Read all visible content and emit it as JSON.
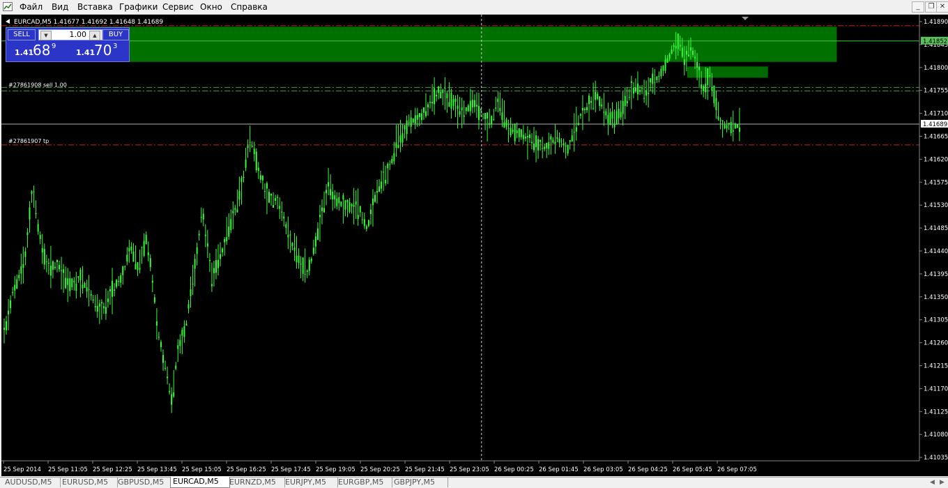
{
  "menu": [
    "Файл",
    "Вид",
    "Вставка",
    "Графики",
    "Сервис",
    "Окно",
    "Справка"
  ],
  "window_controls": [
    "_",
    "❐",
    "✕"
  ],
  "chart": {
    "header": "EURCAD,M5  1.41677 1.41692 1.41648 1.41689",
    "bid": 1.41689,
    "price_axis": [
      "1.41890",
      "1.41845",
      "1.41800",
      "1.41755",
      "1.41710",
      "1.41665",
      "1.41620",
      "1.41575",
      "1.41530",
      "1.41485",
      "1.41440",
      "1.41395",
      "1.41350",
      "1.41305",
      "1.41260",
      "1.41215",
      "1.41170",
      "1.41125",
      "1.41080",
      "1.41035"
    ],
    "price_badges": [
      {
        "value": "1.41852",
        "price": 1.41852,
        "color": "#5cc05c"
      },
      {
        "value": "1.41689",
        "price": 1.41689,
        "color": "#ffffff"
      }
    ],
    "time_axis": [
      "25 Sep 2014",
      "25 Sep 11:05",
      "25 Sep 12:25",
      "25 Sep 13:45",
      "25 Sep 15:05",
      "25 Sep 16:25",
      "25 Sep 17:45",
      "25 Sep 19:05",
      "25 Sep 20:25",
      "25 Sep 21:45",
      "25 Sep 23:05",
      "26 Sep 00:25",
      "26 Sep 01:45",
      "26 Sep 03:05",
      "26 Sep 04:25",
      "26 Sep 05:45",
      "26 Sep 07:05"
    ],
    "order_labels": [
      {
        "text": "#27861908 sell 1.00",
        "price": 1.41758
      },
      {
        "text": "#27861907 tp",
        "price": 1.41648
      }
    ],
    "levels": [
      {
        "price": 1.41882,
        "style": "dashdot",
        "color": "#d02020"
      },
      {
        "price": 1.41761,
        "style": "dashdot",
        "color": "#3aa83a"
      },
      {
        "price": 1.41754,
        "style": "dashdot",
        "color": "#3aa83a"
      },
      {
        "price": 1.41648,
        "style": "dashdot",
        "color": "#d02020"
      },
      {
        "price": 1.41689,
        "style": "solid",
        "color": "#b0b0b0"
      },
      {
        "price": 1.41852,
        "style": "solid",
        "color": "#3cc83c"
      }
    ],
    "zones": [
      {
        "price_top": 1.4188,
        "price_bottom": 1.41811,
        "x_start": 0.005,
        "x_end": 0.91,
        "color": "#007000"
      },
      {
        "price_top": 1.41802,
        "price_bottom": 1.4178,
        "x_start": 0.747,
        "x_end": 0.835,
        "color": "#006a00"
      }
    ],
    "crosshair_x": 0.523,
    "candle_color": "#33ff33",
    "path_pct": [
      [
        0,
        0.74
      ],
      [
        0.012,
        0.62
      ],
      [
        0.025,
        0.55
      ],
      [
        0.033,
        0.39
      ],
      [
        0.043,
        0.52
      ],
      [
        0.05,
        0.57
      ],
      [
        0.06,
        0.56
      ],
      [
        0.073,
        0.61
      ],
      [
        0.086,
        0.59
      ],
      [
        0.096,
        0.63
      ],
      [
        0.108,
        0.67
      ],
      [
        0.12,
        0.62
      ],
      [
        0.132,
        0.58
      ],
      [
        0.14,
        0.52
      ],
      [
        0.148,
        0.57
      ],
      [
        0.157,
        0.5
      ],
      [
        0.163,
        0.58
      ],
      [
        0.17,
        0.71
      ],
      [
        0.178,
        0.79
      ],
      [
        0.185,
        0.87
      ],
      [
        0.192,
        0.74
      ],
      [
        0.2,
        0.7
      ],
      [
        0.21,
        0.57
      ],
      [
        0.218,
        0.44
      ],
      [
        0.228,
        0.59
      ],
      [
        0.24,
        0.53
      ],
      [
        0.252,
        0.45
      ],
      [
        0.262,
        0.38
      ],
      [
        0.27,
        0.27
      ],
      [
        0.28,
        0.35
      ],
      [
        0.29,
        0.41
      ],
      [
        0.3,
        0.42
      ],
      [
        0.31,
        0.48
      ],
      [
        0.32,
        0.54
      ],
      [
        0.333,
        0.58
      ],
      [
        0.345,
        0.48
      ],
      [
        0.355,
        0.38
      ],
      [
        0.365,
        0.42
      ],
      [
        0.377,
        0.43
      ],
      [
        0.39,
        0.44
      ],
      [
        0.398,
        0.48
      ],
      [
        0.406,
        0.41
      ],
      [
        0.416,
        0.37
      ],
      [
        0.424,
        0.33
      ],
      [
        0.432,
        0.28
      ],
      [
        0.444,
        0.24
      ],
      [
        0.455,
        0.23
      ],
      [
        0.466,
        0.2
      ],
      [
        0.476,
        0.17
      ],
      [
        0.486,
        0.19
      ],
      [
        0.494,
        0.2
      ],
      [
        0.5,
        0.22
      ],
      [
        0.508,
        0.21
      ],
      [
        0.516,
        0.2
      ],
      [
        0.524,
        0.23
      ],
      [
        0.533,
        0.24
      ],
      [
        0.54,
        0.19
      ],
      [
        0.548,
        0.24
      ],
      [
        0.558,
        0.26
      ],
      [
        0.57,
        0.27
      ],
      [
        0.58,
        0.29
      ],
      [
        0.592,
        0.3
      ],
      [
        0.606,
        0.27
      ],
      [
        0.615,
        0.31
      ],
      [
        0.625,
        0.25
      ],
      [
        0.632,
        0.22
      ],
      [
        0.64,
        0.2
      ],
      [
        0.648,
        0.18
      ],
      [
        0.655,
        0.21
      ],
      [
        0.664,
        0.24
      ],
      [
        0.674,
        0.22
      ],
      [
        0.683,
        0.18
      ],
      [
        0.692,
        0.16
      ],
      [
        0.7,
        0.18
      ],
      [
        0.708,
        0.15
      ],
      [
        0.716,
        0.14
      ],
      [
        0.723,
        0.11
      ],
      [
        0.73,
        0.08
      ],
      [
        0.736,
        0.06
      ],
      [
        0.744,
        0.09
      ],
      [
        0.752,
        0.08
      ],
      [
        0.758,
        0.12
      ],
      [
        0.764,
        0.17
      ],
      [
        0.77,
        0.13
      ],
      [
        0.776,
        0.18
      ],
      [
        0.783,
        0.25
      ]
    ]
  },
  "tabs": [
    "AUDUSD,M5",
    "EURUSD,M5",
    "GBPUSD,M5",
    "EURCAD,M5",
    "EURNZD,M5",
    "EURJPY,M5",
    "EURGBP,M5",
    "GBPJPY,M5"
  ],
  "active_tab": "EURCAD,M5",
  "one_click": {
    "sell_label": "SELL",
    "buy_label": "BUY",
    "lot": "1.00",
    "sell_price_small": "1.41",
    "sell_price_big": "68",
    "sell_price_sup": "9",
    "buy_price_small": "1.41",
    "buy_price_big": "70",
    "buy_price_sup": "3"
  }
}
